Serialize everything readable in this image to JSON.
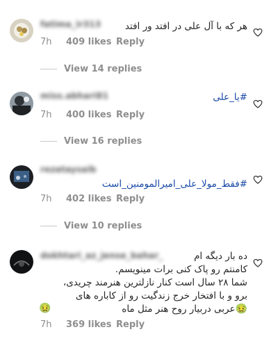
{
  "comments": [
    {
      "username": "fatima_ir313",
      "text": "هر که با آل علی در افتد ور افتد",
      "time": "7h",
      "likes": "409 likes",
      "reply": "Reply",
      "view_replies": "View 14 replies",
      "text_color": "#262626"
    },
    {
      "username": "miss.abhari81",
      "text": "#یا_علی",
      "time": "7h",
      "likes": "400 likes",
      "reply": "Reply",
      "view_replies": "View 16 replies",
      "text_color": "#1a4aa8"
    },
    {
      "username": "rezataysaib",
      "text": "#فقط_مولا_علی_امیرالمومنین_است",
      "time": "7h",
      "likes": "402 likes",
      "reply": "Reply",
      "view_replies": "View 10 replies",
      "text_color": "#1a4aa8"
    },
    {
      "username": "dokhtari_az_jense_bahar_",
      "lines": [
        "ده بار دیگه ام",
        "کامنتم رو پاک کنی برات مینویسم.",
        "شما ۲۸ سال است کنار نازلترین هنرمند چریدی،",
        "برو و با افتخار خرج زندگیت رو از کاباره های",
        "عربی دربیار روح هنر مثل ماه"
      ],
      "time": "7h",
      "likes": "369 likes",
      "reply": "Reply",
      "text_color": "#262626"
    }
  ],
  "icons": {
    "heart": "heart-outline-icon",
    "emoji": "nauseated-face-emoji"
  },
  "colors": {
    "meta": "#8e8e8e",
    "link": "#1a4aa8",
    "divider": "#c7c7c7"
  }
}
